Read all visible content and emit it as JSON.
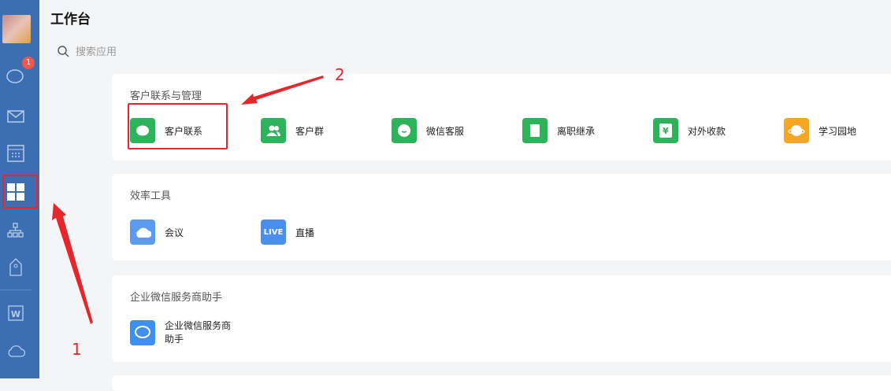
{
  "header": {
    "title": "工作台"
  },
  "search": {
    "placeholder": "搜索应用"
  },
  "sidebar": {
    "badge": "1",
    "items": [
      "messages",
      "mail",
      "calendar",
      "workbench",
      "contacts",
      "tag",
      "weidoc",
      "cloud"
    ]
  },
  "sections": [
    {
      "title": "客户联系与管理",
      "items": [
        {
          "label": "客户联系",
          "icon": "chat-bubble-icon",
          "color": "#2db35a"
        },
        {
          "label": "客户群",
          "icon": "group-icon",
          "color": "#2db35a"
        },
        {
          "label": "微信客服",
          "icon": "service-icon",
          "color": "#2db35a"
        },
        {
          "label": "离职继承",
          "icon": "transfer-icon",
          "color": "#2db35a"
        },
        {
          "label": "对外收款",
          "icon": "yen-icon",
          "color": "#2db35a",
          "glyph": "¥"
        },
        {
          "label": "学习园地",
          "icon": "planet-icon",
          "color": "#f5a623"
        }
      ]
    },
    {
      "title": "效率工具",
      "items": [
        {
          "label": "会议",
          "icon": "cloud-meeting-icon",
          "color": "#5b9cf0"
        },
        {
          "label": "直播",
          "icon": "live-icon",
          "color": "#4a8ff0",
          "glyph": "LIVE"
        }
      ]
    },
    {
      "title": "企业微信服务商助手",
      "items": [
        {
          "label": "企业微信服务商\n助手",
          "label1": "企业微信服务商",
          "label2": "助手",
          "icon": "assistant-icon",
          "color": "#3d8ff0"
        }
      ]
    }
  ],
  "annotations": {
    "one": "1",
    "two": "2"
  }
}
